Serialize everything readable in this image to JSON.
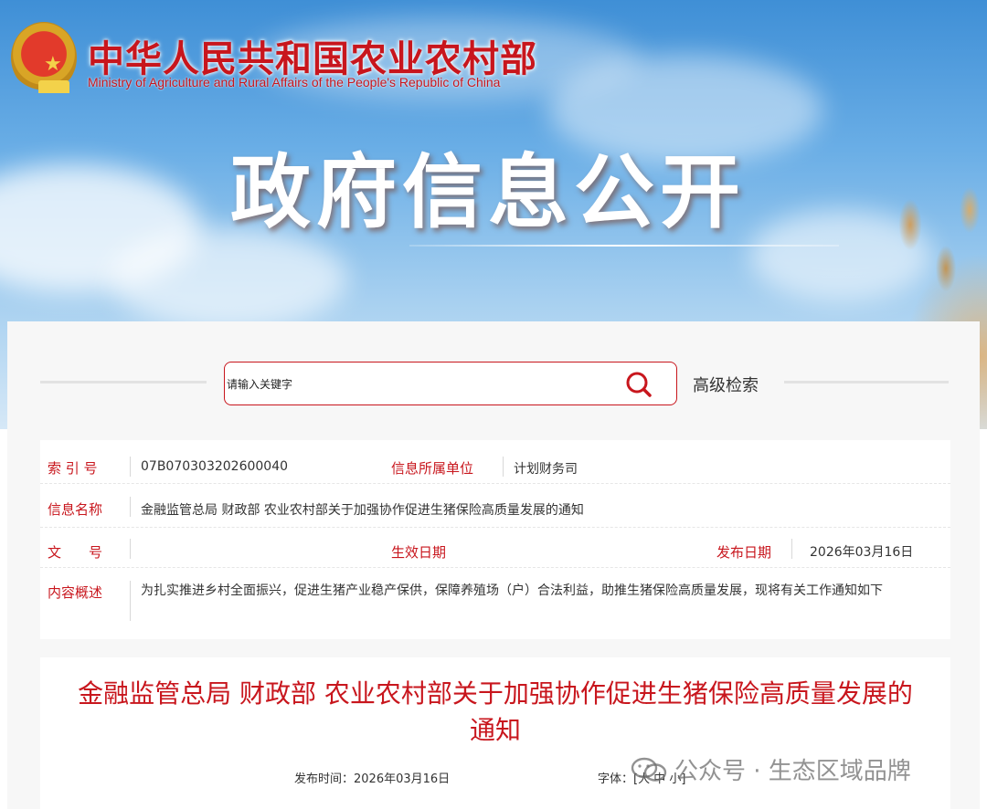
{
  "header": {
    "ministry_cn": "中华人民共和国农业农村部",
    "ministry_en": "Ministry of Agriculture and Rural Affairs of the People's Republic of China",
    "banner_title": "政府信息公开"
  },
  "search": {
    "placeholder": "请输入关键字",
    "advanced_label": "高级检索"
  },
  "meta": {
    "index_label": "索 引 号",
    "index_value": "07B070303202600040",
    "unit_label": "信息所属单位",
    "unit_value": "计划财务司",
    "name_label": "信息名称",
    "name_value": "金融监管总局 财政部 农业农村部关于加强协作促进生猪保险高质量发展的通知",
    "doc_label": "文　　号",
    "effective_label": "生效日期",
    "publish_label": "发布日期",
    "publish_value": "2026年03月16日",
    "summary_label": "内容概述",
    "summary_value": "为扎实推进乡村全面振兴，促进生猪产业稳产保供，保障养殖场（户）合法利益，助推生猪保险高质量发展，现将有关工作通知如下"
  },
  "article": {
    "title": "金融监管总局 财政部 农业农村部关于加强协作促进生猪保险高质量发展的通知",
    "pub_time": "发布时间：2026年03月16日",
    "font_label": "字体：[",
    "font_large": "大",
    "font_medium": "中",
    "font_small": "小",
    "font_close": "]"
  },
  "watermark": {
    "text": "公众号 · 生态区域品牌"
  },
  "colors": {
    "accent": "#c8161d",
    "sky": "#6aaee6"
  }
}
